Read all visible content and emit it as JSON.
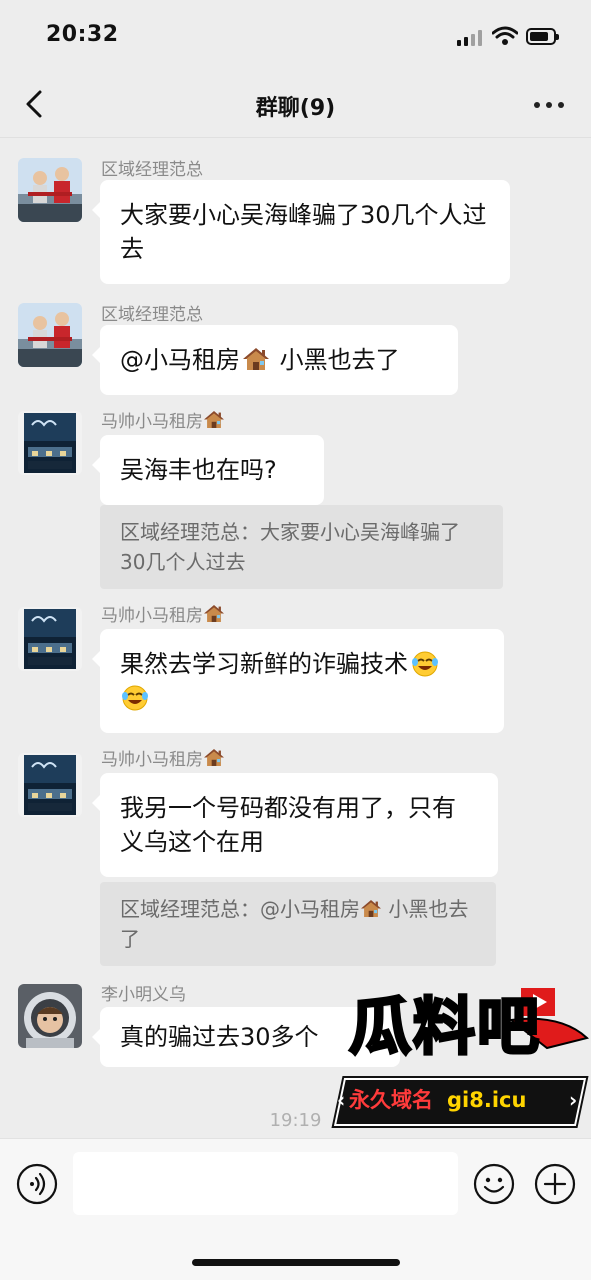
{
  "status_bar": {
    "time": "20:32"
  },
  "nav": {
    "title": "群聊(9)"
  },
  "messages": [
    {
      "sender": "区域经理范总",
      "text": "大家要小心吴海峰骗了30几个人过去"
    },
    {
      "sender": "区域经理范总",
      "text_before": "@小马租房",
      "text_after": " 小黑也去了"
    },
    {
      "sender": "马帅小马租房",
      "text": "吴海丰也在吗?",
      "quote": "区域经理范总：大家要小心吴海峰骗了30几个人过去"
    },
    {
      "sender": "马帅小马租房",
      "text": "果然去学习新鲜的诈骗技术"
    },
    {
      "sender": "马帅小马租房",
      "text": "我另一个号码都没有用了，只有义乌这个在用",
      "quote_before": "区域经理范总：@小马租房",
      "quote_after": " 小黑也去了"
    },
    {
      "sender": "李小明义乌",
      "text": "真的骗过去30多个"
    }
  ],
  "timestamp": "19:19",
  "input": {
    "placeholder": ""
  },
  "watermark": {
    "logo": "瓜料吧",
    "tag": "永久域名",
    "domain": "gi8.icu"
  },
  "icons": {
    "back": "chevron-left-icon",
    "more": "more-dots-icon",
    "voice": "voice-icon",
    "emoji": "emoji-icon",
    "plus": "plus-icon",
    "house": "house-emoji-icon",
    "laugh": "laughing-crying-emoji-icon"
  },
  "colors": {
    "background": "#ededed",
    "bubble": "#ffffff",
    "quote": "#e1e1e1",
    "sender": "#8a8a8a"
  }
}
